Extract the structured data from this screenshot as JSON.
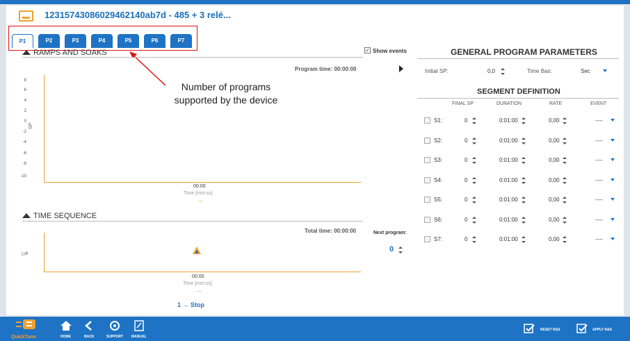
{
  "header": {
    "title": "12315743086029462140ab7d - 485 + 3 relé..."
  },
  "tabs": [
    "P1",
    "P2",
    "P3",
    "P4",
    "P5",
    "P6",
    "P7"
  ],
  "active_tab": "P1",
  "annotation": {
    "line1": "Number of programs",
    "line2": "supported by the device"
  },
  "ramps": {
    "title": "RAMPS AND SOAKS",
    "show_events_label": "Show events",
    "program_time": "Program time: 00:00:00",
    "y_ticks": [
      "8",
      "6",
      "4",
      "2",
      "0",
      "-2",
      "-4",
      "-6",
      "-8",
      "-10"
    ],
    "y_label": "SP",
    "x_tick": "00:00",
    "x_label": "Time [mm:ss]",
    "legend": "—"
  },
  "timeseq": {
    "title": "TIME SEQUENCE",
    "total_time": "Total time: 00:00:00",
    "y_tick": "0",
    "y_label": "SP",
    "x_tick": "00:00",
    "x_label": "Time [mm:ss]",
    "legend": "—",
    "next_program_label": "Next program:",
    "next_program_value": "0",
    "stop_text": "1 → Stop"
  },
  "general": {
    "title": "GENERAL PROGRAM PARAMETERS",
    "initial_sp_label": "Initial SP:",
    "initial_sp_value": "0,0",
    "time_base_label": "Time Bas:",
    "time_base_value": "Sec"
  },
  "segments": {
    "title": "SEGMENT DEFINITION",
    "headers": {
      "final_sp": "FINAL SP",
      "duration": "DURATION",
      "rate": "RATE",
      "event": "EVENT"
    },
    "rows": [
      {
        "name": "S1:",
        "final_sp": "0",
        "duration": "0:01:00",
        "rate": "0,00",
        "event": "----"
      },
      {
        "name": "S2:",
        "final_sp": "0",
        "duration": "0:01:00",
        "rate": "0,00",
        "event": "----"
      },
      {
        "name": "S3:",
        "final_sp": "0",
        "duration": "0:01:00",
        "rate": "0,00",
        "event": "----"
      },
      {
        "name": "S4:",
        "final_sp": "0",
        "duration": "0:01:00",
        "rate": "0,00",
        "event": "----"
      },
      {
        "name": "S5:",
        "final_sp": "0",
        "duration": "0:01:00",
        "rate": "0,00",
        "event": "----"
      },
      {
        "name": "S6:",
        "final_sp": "0",
        "duration": "0:01:00",
        "rate": "0,00",
        "event": "----"
      },
      {
        "name": "S7:",
        "final_sp": "0",
        "duration": "0:01:00",
        "rate": "0,00",
        "event": "----"
      }
    ]
  },
  "footer": {
    "logo": "QuickTune",
    "home": "HOME",
    "back": "BACK",
    "support": "SUPPORT",
    "manual": "MANUAL",
    "reset": "RESET R&S",
    "apply": "APPLY R&S"
  },
  "colors": {
    "accent": "#1e73c4",
    "orange": "#f0a030",
    "red_annotation": "#e01010"
  }
}
